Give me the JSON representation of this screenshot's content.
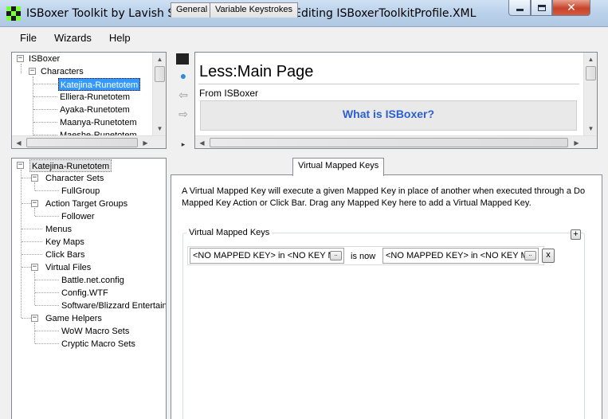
{
  "window": {
    "title": "ISBoxer Toolkit by Lavish Software - Build #41 - Editing ISBoxerToolkitProfile.XML"
  },
  "menu": {
    "file": "File",
    "wizards": "Wizards",
    "help": "Help"
  },
  "top_tree": {
    "root": "ISBoxer",
    "characters": "Characters",
    "items": [
      "Katejina-Runetotem",
      "Elliera-Runetotem",
      "Ayaka-Runetotem",
      "Maanya-Runetotem",
      "Maeshe-Runetotem"
    ]
  },
  "browser": {
    "page_title": "Less:Main Page",
    "from": "From ISBoxer",
    "box_title": "What is ISBoxer?"
  },
  "bottom_tree": {
    "root": "Katejina-Runetotem",
    "character_sets": "Character Sets",
    "fullgroup": "FullGroup",
    "action_target_groups": "Action Target Groups",
    "follower": "Follower",
    "menus": "Menus",
    "key_maps": "Key Maps",
    "click_bars": "Click Bars",
    "virtual_files": "Virtual Files",
    "battlenet": "Battle.net.config",
    "configwtf": "Config.WTF",
    "software": "Software/Blizzard Entertain",
    "game_helpers": "Game Helpers",
    "wow_macro_sets": "WoW Macro Sets",
    "cryptic_macro_sets": "Cryptic Macro Sets"
  },
  "tabs": {
    "general": "General",
    "variable_keystrokes": "Variable Keystrokes",
    "virtual_mapped_keys": "Virtual Mapped Keys"
  },
  "vmk": {
    "description": "A Virtual Mapped Key will execute a given Mapped Key in place of another when executed through a Do Mapped Key Action or Click Bar. Drag any Mapped Key here to add a Virtual Mapped Key.",
    "group_label": "Virtual Mapped Keys",
    "add_label": "+",
    "source_value": "<NO MAPPED KEY> in <NO KEY M",
    "is_now": "is now",
    "target_value": "<NO MAPPED KEY> in <NO KEY M",
    "dots": "..",
    "remove_label": "x"
  }
}
